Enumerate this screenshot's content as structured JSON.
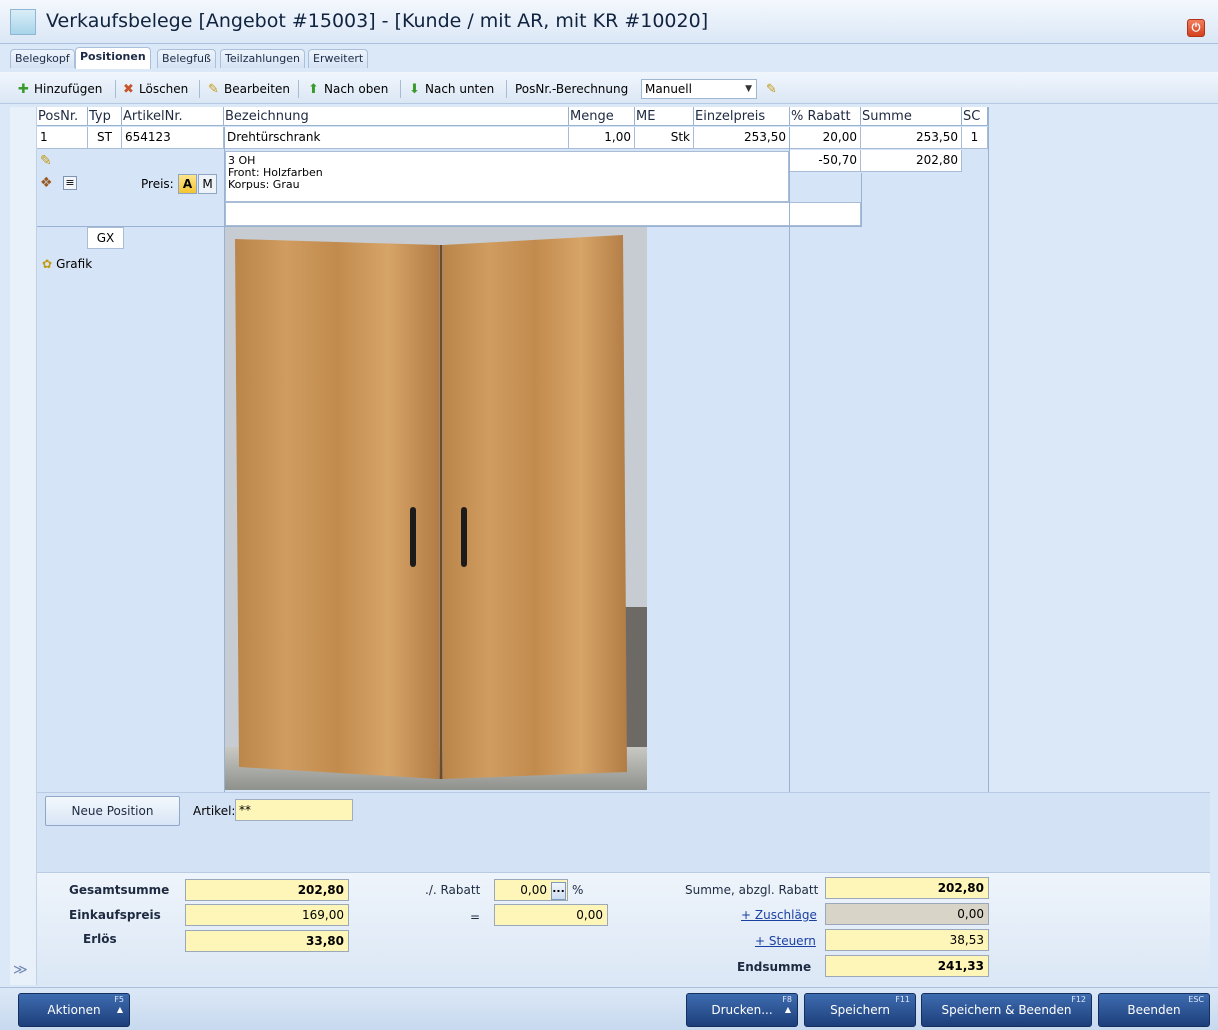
{
  "window": {
    "title": "Verkaufsbelege [Angebot #15003] - [Kunde / mit AR, mit KR #10020]"
  },
  "tabs": [
    {
      "label": "Belegkopf"
    },
    {
      "label": "Positionen"
    },
    {
      "label": "Belegfuß"
    },
    {
      "label": "Teilzahlungen"
    },
    {
      "label": "Erweitert"
    }
  ],
  "toolbar": {
    "add": "Hinzufügen",
    "delete": "Löschen",
    "edit": "Bearbeiten",
    "up": "Nach oben",
    "down": "Nach unten",
    "posnr_label": "PosNr.-Berechnung",
    "posnr_value": "Manuell"
  },
  "table": {
    "headers": [
      "PosNr.",
      "Typ",
      "ArtikelNr.",
      "Bezeichnung",
      "Menge",
      "ME",
      "Einzelpreis",
      "% Rabatt",
      "Summe",
      "SC"
    ],
    "row": {
      "posnr": "1",
      "typ": "ST",
      "artikelnr": "654123",
      "bezeichnung": "Drehtürschrank",
      "menge": "1,00",
      "me": "Stk",
      "einzelpreis": "253,50",
      "rabatt": "20,00",
      "summe": "253,50",
      "sc": "1"
    },
    "subrow": {
      "rabatt": "-50,70",
      "summe": "202,80"
    },
    "description": [
      "3 OH",
      "Front: Holzfarben",
      "Korpus: Grau"
    ],
    "preis_label": "Preis:",
    "preis_a": "A",
    "preis_m": "M",
    "gx_label": "GX",
    "grafik_label": "Grafik"
  },
  "newpos": {
    "button": "Neue Position",
    "artikel_label": "Artikel:",
    "artikel_value": "**"
  },
  "totals": {
    "gesamtsumme_label": "Gesamtsumme",
    "gesamtsumme": "202,80",
    "einkaufspreis_label": "Einkaufspreis",
    "einkaufspreis": "169,00",
    "erloes_label": "Erlös",
    "erloes": "33,80",
    "rabatt_label": "./. Rabatt",
    "rabatt_percent": "0,00",
    "percent_sign": "%",
    "equals": "=",
    "rabatt_amount": "0,00",
    "summe_abzgl_label": "Summe, abzgl. Rabatt",
    "summe_abzgl": "202,80",
    "zuschlaege_label": "+ Zuschläge",
    "zuschlaege": "0,00",
    "steuern_label": "+ Steuern",
    "steuern": "38,53",
    "endsumme_label": "Endsumme",
    "endsumme": "241,33"
  },
  "buttons": {
    "aktionen": "Aktionen",
    "aktionen_key": "F5",
    "drucken": "Drucken...",
    "drucken_key": "F8",
    "speichern": "Speichern",
    "speichern_key": "F11",
    "speichern_beenden": "Speichern & Beenden",
    "speichern_beenden_key": "F12",
    "beenden": "Beenden",
    "beenden_key": "ESC"
  },
  "colors": {
    "accent": "#1d3f7b",
    "field_yellow": "#fdf6b8",
    "grid_bg": "#d5e4f6"
  }
}
